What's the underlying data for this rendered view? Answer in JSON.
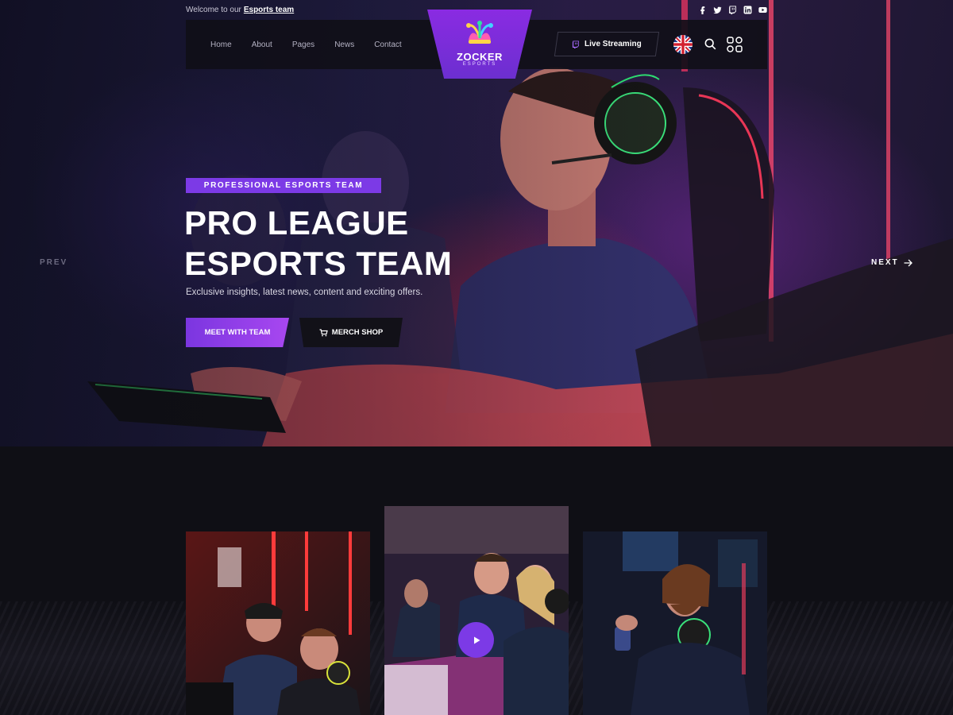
{
  "topbar": {
    "welcome_prefix": "Welcome to our",
    "welcome_link": "Esports team",
    "socials": [
      "facebook-icon",
      "twitter-icon",
      "twitch-icon",
      "linkedin-icon",
      "youtube-icon"
    ]
  },
  "nav": {
    "items": [
      "Home",
      "About",
      "Pages",
      "News",
      "Contact"
    ],
    "live_label": "Live Streaming"
  },
  "logo": {
    "name": "ZOCKER",
    "tagline": "ESPORTS"
  },
  "hero": {
    "badge": "PROFESSIONAL ESPORTS TEAM",
    "headline_line1": "PRO LEAGUE",
    "headline_line2": "ESPORTS TEAM",
    "subtitle": "Exclusive insights, latest news, content and exciting offers.",
    "primary_button": "MEET WITH TEAM",
    "secondary_button": "MERCH SHOP",
    "prev_label": "PREV",
    "next_label": "NEXT"
  },
  "colors": {
    "accent": "#7c3ae6",
    "accent_light": "#a847f0",
    "background": "#0f0f15",
    "nav_bg": "#100f18"
  }
}
